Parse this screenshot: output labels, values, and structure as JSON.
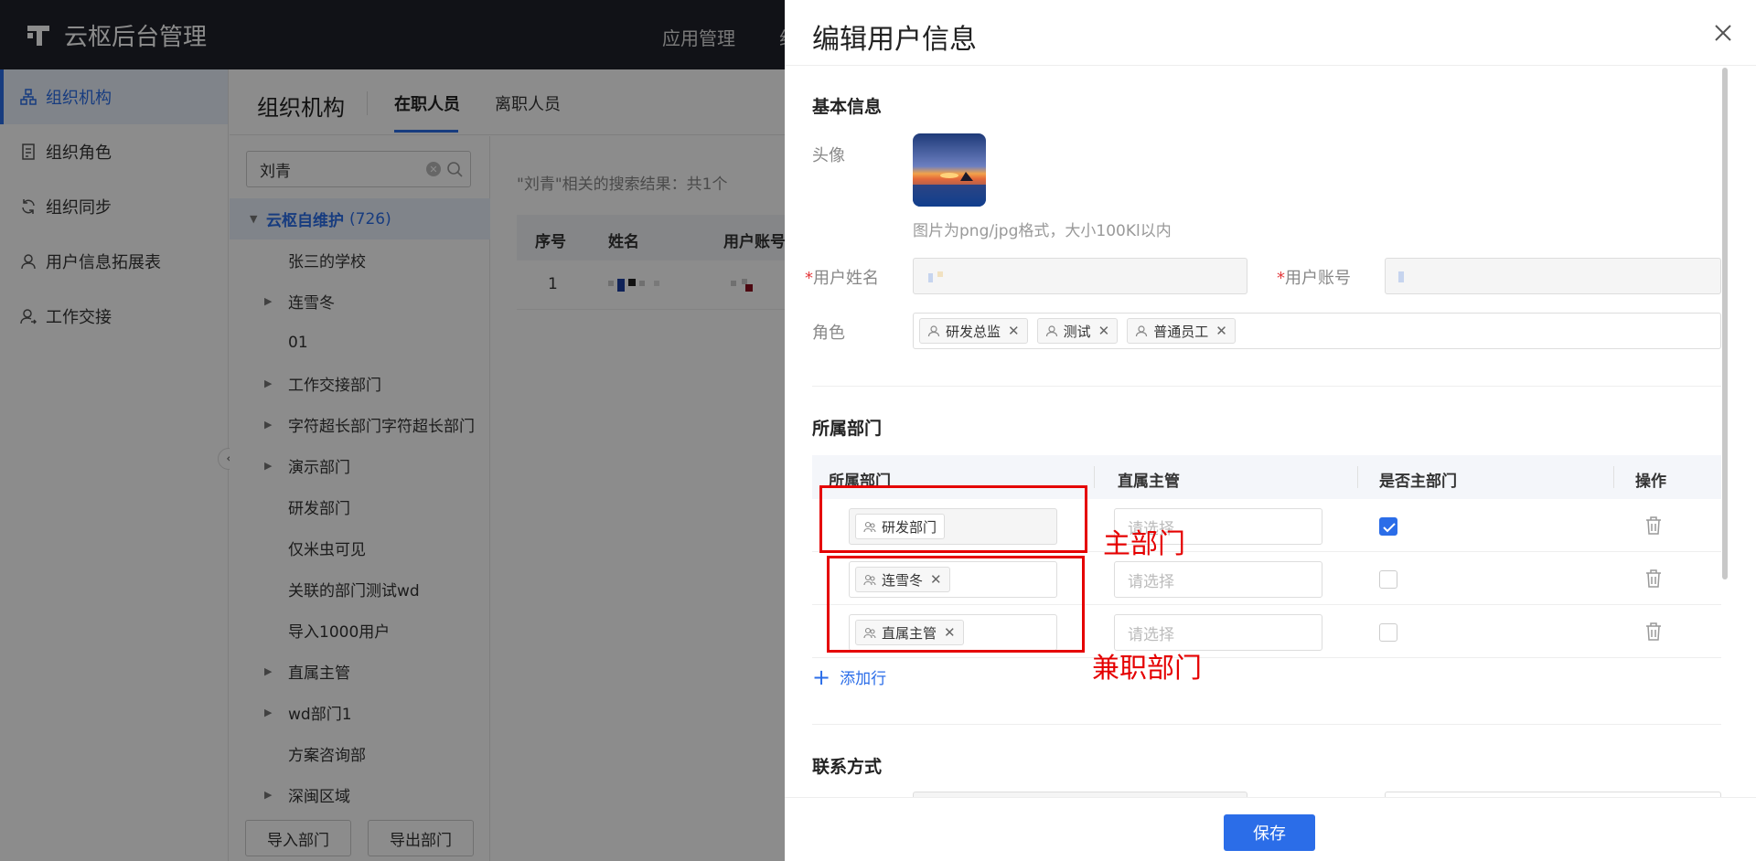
{
  "app": {
    "brand": "云枢后台管理",
    "nav": [
      "应用管理",
      "组"
    ]
  },
  "sidebar": {
    "items": [
      {
        "label": "组织机构",
        "icon": "org-icon"
      },
      {
        "label": "组织角色",
        "icon": "role-doc-icon"
      },
      {
        "label": "组织同步",
        "icon": "sync-icon"
      },
      {
        "label": "用户信息拓展表",
        "icon": "user-icon"
      },
      {
        "label": "工作交接",
        "icon": "handover-user-icon"
      }
    ]
  },
  "header": {
    "title": "组织机构",
    "tabs": [
      "在职人员",
      "离职人员"
    ]
  },
  "tree": {
    "search_value": "刘青",
    "root": {
      "name": "云枢自维护",
      "count": "(726)"
    },
    "nodes": [
      {
        "label": "张三的学校",
        "caret": false
      },
      {
        "label": "连雪冬",
        "caret": true
      },
      {
        "label": "01",
        "caret": false
      },
      {
        "label": "工作交接部门",
        "caret": true
      },
      {
        "label": "字符超长部门字符超长部门",
        "caret": true
      },
      {
        "label": "演示部门",
        "caret": true
      },
      {
        "label": "研发部门",
        "caret": false
      },
      {
        "label": "仅米虫可见",
        "caret": false
      },
      {
        "label": "关联的部门测试wd",
        "caret": false
      },
      {
        "label": "导入1000用户",
        "caret": false
      },
      {
        "label": "直属主管",
        "caret": true
      },
      {
        "label": "wd部门1",
        "caret": true
      },
      {
        "label": "方案咨询部",
        "caret": false
      },
      {
        "label": "深闽区域",
        "caret": true
      }
    ],
    "buttons": [
      "导入部门",
      "导出部门"
    ]
  },
  "results": {
    "summary": "\"刘青\"相关的搜索结果：共1个",
    "columns": [
      "序号",
      "姓名",
      "用户账号"
    ],
    "rows": [
      {
        "index": "1"
      }
    ]
  },
  "drawer": {
    "title": "编辑用户信息",
    "basic": {
      "section_title": "基本信息",
      "avatar_label": "头像",
      "avatar_hint": "图片为png/jpg格式，大小100Kl以内",
      "name_label": "用户姓名",
      "account_label": "用户账号",
      "role_label": "角色",
      "roles": [
        "研发总监",
        "测试",
        "普通员工"
      ]
    },
    "dept": {
      "section_title": "所属部门",
      "columns": [
        "所属部门",
        "直属主管",
        "是否主部门",
        "操作"
      ],
      "rows": [
        {
          "dept": "研发部门",
          "removable": false,
          "manager_placeholder": "请选择",
          "is_main": true
        },
        {
          "dept": "连雪冬",
          "removable": true,
          "manager_placeholder": "请选择",
          "is_main": false
        },
        {
          "dept": "直属主管",
          "removable": true,
          "manager_placeholder": "请选择",
          "is_main": false
        }
      ],
      "add_row": "添加行"
    },
    "contact": {
      "section_title": "联系方式"
    },
    "save": "保存"
  },
  "annotations": {
    "main_dept": "主部门",
    "part_time_dept": "兼职部门"
  },
  "colors": {
    "primary": "#2b6de8",
    "annotation": "#e50000",
    "topbar": "#20222a"
  }
}
